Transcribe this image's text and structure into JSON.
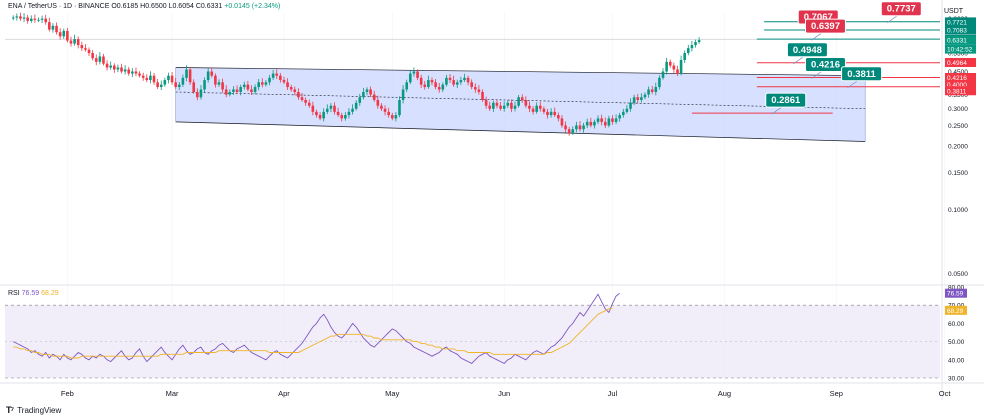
{
  "header": {
    "symbol": "ENA / TetherUS · 1D · BINANCE",
    "ohlc": "O0.6185 H0.6500 L0.6054 C0.6331",
    "change": "+0.0145 (+2.34%)"
  },
  "axis_unit": "USDT",
  "rsi_header": {
    "label": "RSI",
    "value1": "76.59",
    "value2": "68.29"
  },
  "footer": {
    "logo": "T⁷",
    "brand": "TradingView"
  },
  "colors": {
    "bull": "#089981",
    "bear": "#f23645",
    "channel_fill": "#c9d6ff",
    "channel_line": "#131722",
    "resistance": "#f23645",
    "target": "#00897b",
    "rsi_line": "#7e57c2",
    "rsi_ma": "#f0b429",
    "rsi_band": "#ede7f6"
  },
  "chart_data": [
    {
      "type": "candlestick",
      "title": "ENA / TetherUS · 1D · BINANCE",
      "ylabel": "USDT",
      "x_ticks": [
        "Feb",
        "Mar",
        "Apr",
        "May",
        "Jun",
        "Jul",
        "Aug",
        "Sep",
        "Oct"
      ],
      "y_ticks": [
        0.05,
        0.1,
        0.15,
        0.2,
        0.25,
        0.3,
        0.35,
        0.4,
        0.45,
        0.55,
        0.65,
        0.75,
        0.8
      ],
      "y_scale": "log",
      "ylim": [
        0.045,
        0.86
      ],
      "price_badges": [
        {
          "label": "0.7721",
          "color": "#00897b"
        },
        {
          "label": "0.7083",
          "color": "#00897b"
        },
        {
          "label": "0.6397",
          "color": "#00897b"
        },
        {
          "label": "0.6331",
          "color": "#089981"
        },
        {
          "label": "10:42:52",
          "color": "#089981"
        },
        {
          "label": "0.4964",
          "color": "#f23645"
        },
        {
          "label": "0.4216",
          "color": "#f23645"
        },
        {
          "label": "0.4000",
          "color": "#f23645"
        },
        {
          "label": "0.3811",
          "color": "#f23645"
        }
      ],
      "levels": [
        {
          "value": 0.7737,
          "label": "0.7737",
          "kind": "target",
          "from_day": 210,
          "box_day": 248
        },
        {
          "value": 0.7067,
          "label": "0.7067",
          "kind": "target",
          "from_day": 210,
          "box_day": 225
        },
        {
          "value": 0.6397,
          "label": "0.6397",
          "kind": "target",
          "from_day": 208,
          "box_day": 227
        },
        {
          "value": 0.4948,
          "label": "0.4948",
          "kind": "resistance",
          "from_day": 208,
          "box_day": 222
        },
        {
          "value": 0.4216,
          "label": "0.4216",
          "kind": "resistance",
          "from_day": 208,
          "box_day": 227
        },
        {
          "value": 0.3811,
          "label": "0.3811",
          "kind": "resistance",
          "from_day": 208,
          "box_day": 237
        },
        {
          "value": 0.2861,
          "label": "0.2861",
          "kind": "resistance",
          "from_day": 190,
          "box_day": 216
        }
      ],
      "channel": {
        "start_day": 47,
        "end_day": 238,
        "upper": [
          0.47,
          0.43
        ],
        "lower": [
          0.26,
          0.21
        ],
        "mid": [
          0.36,
          0.3
        ]
      },
      "ohlc_days": {
        "first_month_start_day": 17,
        "closes": [
          0.81,
          0.82,
          0.8,
          0.81,
          0.78,
          0.8,
          0.79,
          0.79,
          0.8,
          0.77,
          0.71,
          0.74,
          0.69,
          0.66,
          0.7,
          0.63,
          0.61,
          0.64,
          0.6,
          0.58,
          0.57,
          0.55,
          0.52,
          0.5,
          0.53,
          0.49,
          0.47,
          0.48,
          0.46,
          0.47,
          0.45,
          0.46,
          0.44,
          0.45,
          0.44,
          0.43,
          0.42,
          0.41,
          0.43,
          0.4,
          0.38,
          0.39,
          0.41,
          0.43,
          0.4,
          0.38,
          0.39,
          0.42,
          0.46,
          0.4,
          0.36,
          0.34,
          0.37,
          0.41,
          0.45,
          0.43,
          0.39,
          0.4,
          0.37,
          0.35,
          0.36,
          0.37,
          0.36,
          0.38,
          0.39,
          0.37,
          0.36,
          0.38,
          0.4,
          0.39,
          0.4,
          0.42,
          0.44,
          0.43,
          0.41,
          0.4,
          0.38,
          0.37,
          0.36,
          0.34,
          0.33,
          0.32,
          0.31,
          0.29,
          0.28,
          0.27,
          0.29,
          0.3,
          0.31,
          0.29,
          0.28,
          0.27,
          0.28,
          0.29,
          0.3,
          0.32,
          0.34,
          0.36,
          0.37,
          0.35,
          0.33,
          0.31,
          0.3,
          0.29,
          0.28,
          0.27,
          0.28,
          0.33,
          0.37,
          0.4,
          0.44,
          0.45,
          0.42,
          0.39,
          0.38,
          0.41,
          0.4,
          0.38,
          0.37,
          0.39,
          0.42,
          0.41,
          0.39,
          0.4,
          0.41,
          0.42,
          0.4,
          0.38,
          0.37,
          0.36,
          0.33,
          0.31,
          0.3,
          0.32,
          0.31,
          0.3,
          0.31,
          0.32,
          0.3,
          0.31,
          0.34,
          0.33,
          0.31,
          0.3,
          0.29,
          0.31,
          0.3,
          0.29,
          0.28,
          0.29,
          0.28,
          0.27,
          0.25,
          0.24,
          0.23,
          0.24,
          0.25,
          0.24,
          0.25,
          0.26,
          0.25,
          0.26,
          0.27,
          0.26,
          0.25,
          0.27,
          0.26,
          0.27,
          0.28,
          0.29,
          0.3,
          0.32,
          0.34,
          0.33,
          0.34,
          0.35,
          0.37,
          0.36,
          0.38,
          0.42,
          0.45,
          0.5,
          0.48,
          0.46,
          0.44,
          0.51,
          0.55,
          0.58,
          0.6,
          0.62,
          0.6331
        ]
      }
    },
    {
      "type": "line",
      "title": "RSI",
      "ylim": [
        30,
        80
      ],
      "y_ticks": [
        30.0,
        40.0,
        50.0,
        60.0,
        70.0,
        80.0
      ],
      "y_badges": [
        {
          "label": "76.59",
          "color": "#7e57c2"
        },
        {
          "label": "68.29",
          "color": "#f0b429"
        }
      ],
      "bands": [
        30,
        70
      ],
      "midline": 50,
      "series": [
        {
          "name": "RSI",
          "values": [
            50,
            49,
            48,
            47,
            46,
            44,
            45,
            43,
            42,
            44,
            41,
            43,
            42,
            40,
            43,
            41,
            40,
            42,
            44,
            43,
            41,
            40,
            42,
            41,
            43,
            42,
            40,
            39,
            41,
            43,
            45,
            42,
            40,
            41,
            44,
            46,
            42,
            39,
            41,
            43,
            45,
            47,
            44,
            42,
            40,
            43,
            46,
            48,
            45,
            43,
            44,
            46,
            47,
            44,
            43,
            45,
            46,
            48,
            49,
            47,
            45,
            44,
            46,
            47,
            48,
            46,
            44,
            43,
            42,
            41,
            40,
            42,
            44,
            45,
            43,
            42,
            41,
            43,
            45,
            47,
            49,
            52,
            55,
            58,
            60,
            63,
            65,
            62,
            58,
            55,
            53,
            52,
            54,
            57,
            60,
            58,
            55,
            52,
            50,
            48,
            47,
            49,
            51,
            53,
            55,
            57,
            56,
            54,
            52,
            50,
            49,
            47,
            46,
            45,
            44,
            43,
            42,
            43,
            44,
            46,
            47,
            45,
            44,
            43,
            41,
            40,
            39,
            38,
            40,
            42,
            43,
            44,
            42,
            41,
            40,
            39,
            38,
            40,
            41,
            43,
            42,
            41,
            40,
            42,
            44,
            45,
            44,
            43,
            45,
            47,
            48,
            50,
            52,
            55,
            58,
            60,
            63,
            66,
            64,
            67,
            70,
            73,
            76,
            72,
            68,
            66,
            71,
            75,
            76.59
          ]
        },
        {
          "name": "RSI MA",
          "values": [
            47,
            47,
            46,
            46,
            45,
            45,
            44,
            44,
            43,
            43,
            43,
            42,
            42,
            42,
            42,
            42,
            41,
            41,
            41,
            42,
            42,
            42,
            42,
            42,
            42,
            42,
            42,
            42,
            42,
            42,
            42,
            42,
            42,
            42,
            42,
            42,
            42,
            42,
            42,
            42,
            42,
            43,
            43,
            43,
            43,
            43,
            43,
            43,
            44,
            44,
            44,
            44,
            44,
            44,
            44,
            44,
            44,
            45,
            45,
            45,
            45,
            45,
            45,
            45,
            45,
            45,
            45,
            45,
            45,
            45,
            45,
            44,
            44,
            44,
            44,
            44,
            44,
            44,
            44,
            44,
            45,
            46,
            47,
            48,
            49,
            50,
            51,
            52,
            53,
            53,
            54,
            54,
            54,
            54,
            54,
            54,
            54,
            54,
            53,
            53,
            52,
            52,
            51,
            51,
            51,
            51,
            51,
            51,
            51,
            51,
            51,
            50,
            50,
            49,
            49,
            48,
            48,
            47,
            47,
            46,
            46,
            46,
            46,
            45,
            45,
            45,
            44,
            44,
            44,
            44,
            44,
            44,
            44,
            43,
            43,
            43,
            43,
            43,
            43,
            43,
            43,
            43,
            43,
            43,
            43,
            43,
            43,
            43,
            44,
            44,
            45,
            46,
            47,
            48,
            49,
            51,
            53,
            55,
            57,
            59,
            61,
            63,
            65,
            66,
            67,
            68,
            68.29
          ]
        }
      ]
    }
  ]
}
